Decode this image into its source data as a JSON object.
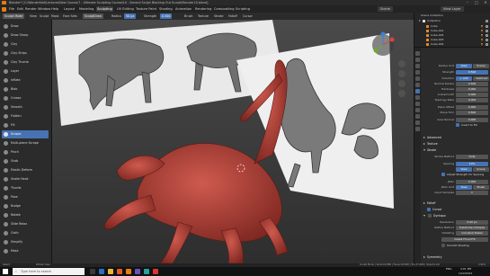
{
  "window": {
    "title": "Blender* [C:\\Wonderfold\\Lectures\\New Course\\7 - Ultimate Sculpting Course\\10 - Second Sculpt Blocking Out Sculpt\\Monster10.blend]",
    "minimize": "–",
    "maximize": "□",
    "close": "✕"
  },
  "menu": {
    "items": [
      "File",
      "Edit",
      "Render",
      "Window",
      "Help"
    ],
    "workspaces": [
      "Layout",
      "Modeling",
      "Sculpting",
      "UV Editing",
      "Texture Paint",
      "Shading",
      "Animation",
      "Rendering",
      "Compositing",
      "Scripting"
    ],
    "active_workspace": "Sculpting",
    "scene_label": "Scene",
    "view_layer_label": "View Layer"
  },
  "tool_header": {
    "mode": "Sculpt Mode",
    "view": "View",
    "sculpt": "Sculpt",
    "mask": "Mask",
    "face_sets": "Face Sets",
    "brush_name": "SculptDraw",
    "radius_label": "Radius",
    "radius_value": "50 px",
    "strength_label": "Strength",
    "strength_value": "0.500",
    "brush_menu": "Brush",
    "texture_menu": "Texture",
    "stroke_menu": "Stroke",
    "falloff_menu": "Falloff",
    "cursor_menu": "Cursor"
  },
  "tools": [
    {
      "label": "Draw",
      "icon": "draw-brush-icon"
    },
    {
      "label": "Draw Sharp",
      "icon": "draw-sharp-brush-icon"
    },
    {
      "label": "Clay",
      "icon": "clay-brush-icon"
    },
    {
      "label": "Clay Strips",
      "icon": "clay-strips-brush-icon"
    },
    {
      "label": "Clay Thumb",
      "icon": "clay-thumb-brush-icon"
    },
    {
      "label": "Layer",
      "icon": "layer-brush-icon"
    },
    {
      "label": "Inflate",
      "icon": "inflate-brush-icon"
    },
    {
      "label": "Blob",
      "icon": "blob-brush-icon"
    },
    {
      "label": "Crease",
      "icon": "crease-brush-icon"
    },
    {
      "label": "Smooth",
      "icon": "smooth-brush-icon"
    },
    {
      "label": "Flatten",
      "icon": "flatten-brush-icon"
    },
    {
      "label": "Fill",
      "icon": "fill-brush-icon"
    },
    {
      "label": "Scrape",
      "icon": "scrape-brush-icon"
    },
    {
      "label": "Multi-plane Scrape",
      "icon": "multiplane-scrape-brush-icon"
    },
    {
      "label": "Pinch",
      "icon": "pinch-brush-icon"
    },
    {
      "label": "Grab",
      "icon": "grab-brush-icon"
    },
    {
      "label": "Elastic Deform",
      "icon": "elastic-deform-brush-icon"
    },
    {
      "label": "Snake Hook",
      "icon": "snake-hook-brush-icon"
    },
    {
      "label": "Thumb",
      "icon": "thumb-brush-icon"
    },
    {
      "label": "Pose",
      "icon": "pose-brush-icon"
    },
    {
      "label": "Nudge",
      "icon": "nudge-brush-icon"
    },
    {
      "label": "Rotate",
      "icon": "rotate-brush-icon"
    },
    {
      "label": "Slide Relax",
      "icon": "slide-relax-brush-icon"
    },
    {
      "label": "Cloth",
      "icon": "cloth-brush-icon"
    },
    {
      "label": "Simplify",
      "icon": "simplify-brush-icon"
    },
    {
      "label": "Mask",
      "icon": "mask-brush-icon"
    }
  ],
  "active_tool": "Scrape",
  "outliner": {
    "root": "Scene Collection",
    "items": [
      "Collection",
      "Cube",
      "Cube.001",
      "Cube.002",
      "Cube.003",
      "Cube.004"
    ]
  },
  "properties": {
    "radius_unit_label": "Radius Unit",
    "radius_unit_view": "View",
    "radius_unit_scene": "Scene",
    "strength_label": "Strength",
    "strength_value": "0.500",
    "direction_label": "Direction",
    "direction_add": "+ Add",
    "direction_sub": "- Subtract",
    "normal_radius_label": "Normal Radius",
    "normal_radius_value": "0.500",
    "hardness_label": "Hardness",
    "hardness_value": "0.000",
    "autosmooth_label": "Autosmooth",
    "autosmooth_value": "0.000",
    "topology_rake_label": "Topology Rake",
    "topology_rake_value": "0.000",
    "plane_offset_label": "Plane Offset",
    "plane_offset_value": "0.000",
    "plane_trim_label": "Plane Trim",
    "plane_trim_value": "0.500",
    "area_normal_label": "Area Normal",
    "area_normal_value": "0.000",
    "invert_to_fill": "Invert to Fill",
    "advanced": "Advanced",
    "texture": "Texture",
    "stroke": "Stroke",
    "stroke_method_label": "Stroke Method",
    "stroke_method_value": "Dots",
    "spacing_label": "Spacing",
    "spacing_value": "10%",
    "spacing_view": "View",
    "spacing_scene": "Scene",
    "adjust_strength": "Adjust Strength for Spacing",
    "jitter_label": "Jitter",
    "jitter_value": "0.000",
    "jitter_unit_label": "Jitter Unit",
    "jitter_view": "View",
    "jitter_brush": "Brush",
    "input_samples_label": "Input Samples",
    "input_samples_value": "1",
    "falloff": "Falloff",
    "cursor": "Cursor",
    "dyntopo": "Dyntopo",
    "resolution_label": "Resolution",
    "resolution_value": "6.00 px",
    "refine_method_label": "Refine Method",
    "refine_method_value": "Subdivide Collapse",
    "detailing_label": "Detailing",
    "detailing_value": "Constant Detail",
    "detail_flood_fill": "Detail Flood Fill",
    "smooth_shading": "Smooth Shading",
    "symmetry": "Symmetry"
  },
  "statusbar": {
    "left": "Select",
    "middle": "Rotate View",
    "right": "Sculpt Mode | Verts:18,880 | Faces:18,848 | Tris:37,696 | Objects:1/6",
    "version": "2.90.0"
  },
  "taskbar": {
    "search_placeholder": "Type here to search",
    "time": "4:01 PM",
    "date": "1/22/2021",
    "lang": "ENG"
  },
  "colors": {
    "accent": "#4772b3",
    "model": "#b8433a",
    "panel": "#2b2b2b",
    "viewport_bg": "#3d3d3d"
  }
}
